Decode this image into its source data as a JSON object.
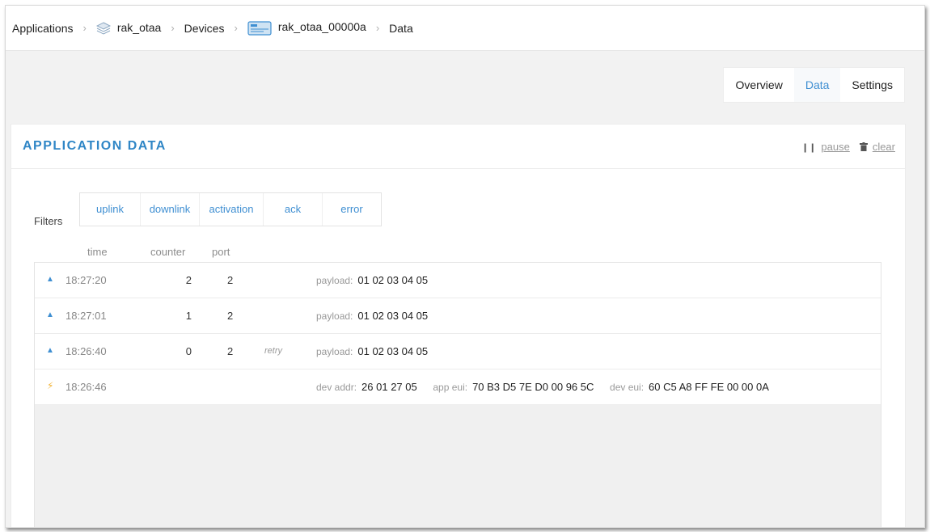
{
  "breadcrumb": {
    "applications": "Applications",
    "app": "rak_otaa",
    "devices": "Devices",
    "device": "rak_otaa_00000a",
    "current": "Data",
    "separator": "›"
  },
  "tabs": [
    "Overview",
    "Data",
    "Settings"
  ],
  "active_tab": "Data",
  "panel": {
    "title": "APPLICATION DATA",
    "pause": "pause",
    "clear": "clear"
  },
  "filters": {
    "label": "Filters",
    "items": [
      "uplink",
      "downlink",
      "activation",
      "ack",
      "error"
    ]
  },
  "columns": {
    "time": "time",
    "counter": "counter",
    "port": "port"
  },
  "rows": [
    {
      "type": "uplink",
      "time": "18:27:20",
      "counter": "2",
      "port": "2",
      "payload_label": "payload:",
      "payload": "01 02 03 04 05"
    },
    {
      "type": "uplink",
      "time": "18:27:01",
      "counter": "1",
      "port": "2",
      "payload_label": "payload:",
      "payload": "01 02 03 04 05"
    },
    {
      "type": "uplink",
      "time": "18:26:40",
      "counter": "0",
      "port": "2",
      "retry": "retry",
      "payload_label": "payload:",
      "payload": "01 02 03 04 05"
    }
  ],
  "activation": {
    "time": "18:26:46",
    "dev_addr_label": "dev addr:",
    "dev_addr": "26 01 27 05",
    "app_eui_label": "app eui:",
    "app_eui": "70 B3 D5 7E D0 00 96 5C",
    "dev_eui_label": "dev eui:",
    "dev_eui": "60 C5 A8 FF FE 00 00 0A"
  },
  "colors": {
    "accent": "#3f8fd2",
    "title": "#2f86c6",
    "bolt": "#f2b53a"
  }
}
